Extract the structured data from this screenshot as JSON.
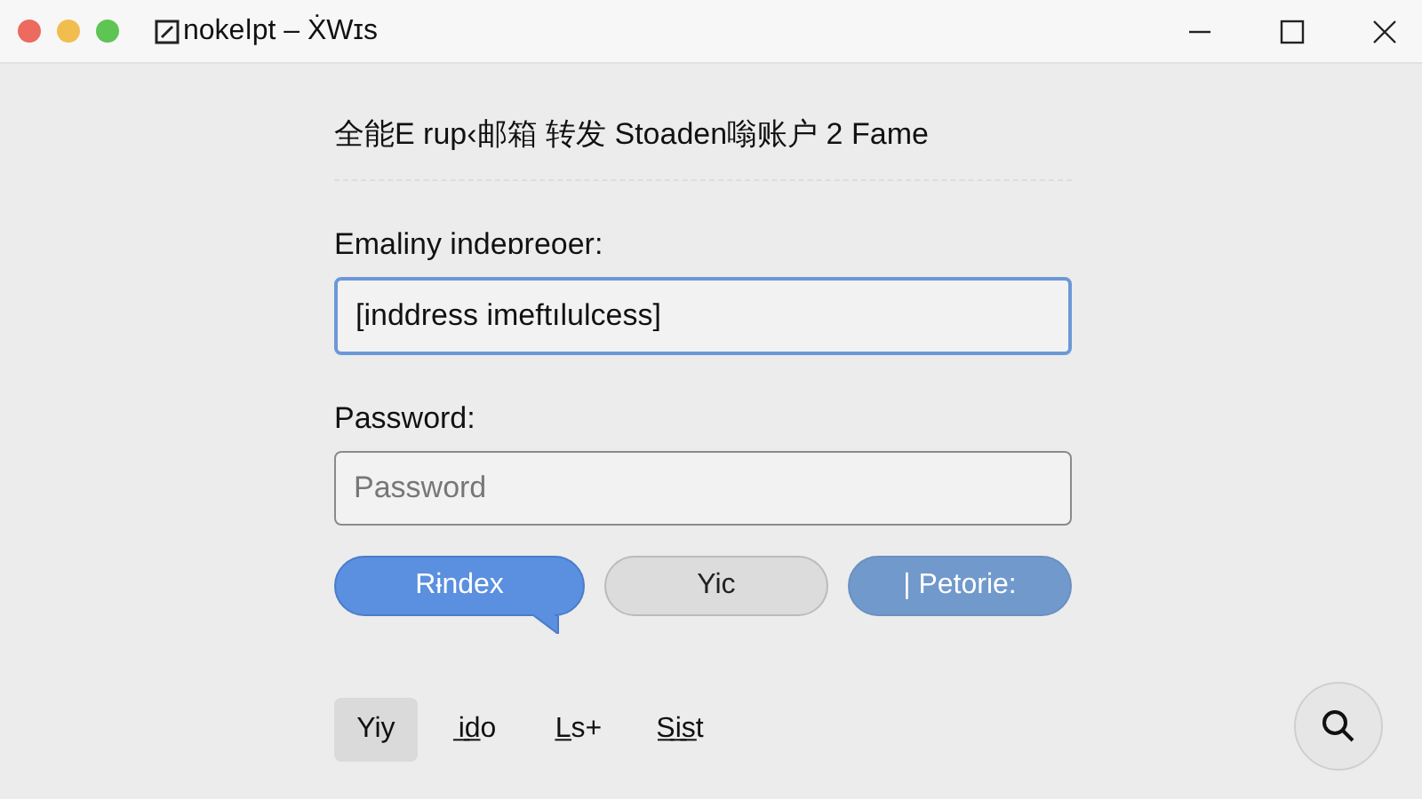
{
  "window": {
    "title": "nokeǀpt – ẊWɪs"
  },
  "heading": "全能E rup‹邮箱 转发 Stoaden嗡账户 2 Fame",
  "fields": [
    {
      "label": "Emaliny indeɒreoer:",
      "value": "[inddress imeftılulcess]",
      "focused": true
    },
    {
      "label": "Password:",
      "placeholder": "Password",
      "focused": false
    }
  ],
  "buttons": [
    {
      "label": "Rɨndex",
      "kind": "primary"
    },
    {
      "label": "Yic",
      "kind": "secondary"
    },
    {
      "label": "| Petorie:",
      "kind": "muted"
    }
  ],
  "tabs": [
    {
      "label": "Yiy",
      "selected": true
    },
    {
      "label": "i̲d̲o",
      "selected": false
    },
    {
      "label": "L̲s+",
      "selected": false
    },
    {
      "label": "S̲i̲s̲t",
      "selected": false
    }
  ]
}
